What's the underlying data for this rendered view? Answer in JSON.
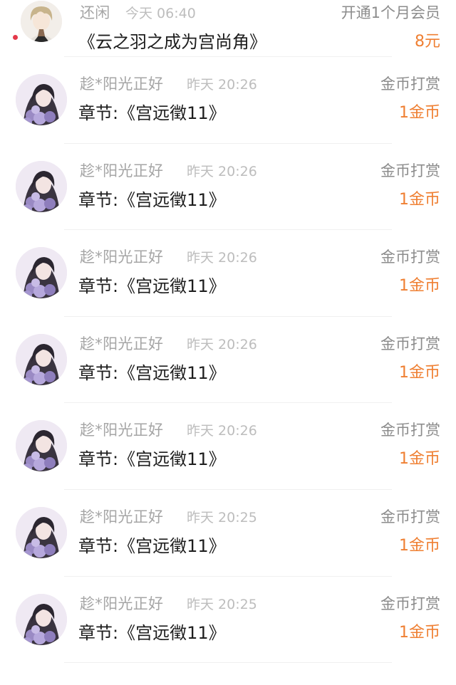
{
  "records": [
    {
      "user": "还闲",
      "time": "今天 06:40",
      "type": "开通1个月会员",
      "item": "《云之羽之成为宫尚角》",
      "amount": "8元",
      "avatar": "male-avatar",
      "unread": true
    },
    {
      "user": "趁*阳光正好",
      "time": "昨天 20:26",
      "type": "金币打赏",
      "item": "章节:《宫远徵11》",
      "amount": "1金币",
      "avatar": "female-avatar"
    },
    {
      "user": "趁*阳光正好",
      "time": "昨天 20:26",
      "type": "金币打赏",
      "item": "章节:《宫远徵11》",
      "amount": "1金币",
      "avatar": "female-avatar"
    },
    {
      "user": "趁*阳光正好",
      "time": "昨天 20:26",
      "type": "金币打赏",
      "item": "章节:《宫远徵11》",
      "amount": "1金币",
      "avatar": "female-avatar"
    },
    {
      "user": "趁*阳光正好",
      "time": "昨天 20:26",
      "type": "金币打赏",
      "item": "章节:《宫远徵11》",
      "amount": "1金币",
      "avatar": "female-avatar"
    },
    {
      "user": "趁*阳光正好",
      "time": "昨天 20:26",
      "type": "金币打赏",
      "item": "章节:《宫远徵11》",
      "amount": "1金币",
      "avatar": "female-avatar"
    },
    {
      "user": "趁*阳光正好",
      "time": "昨天 20:25",
      "type": "金币打赏",
      "item": "章节:《宫远徵11》",
      "amount": "1金币",
      "avatar": "female-avatar"
    },
    {
      "user": "趁*阳光正好",
      "time": "昨天 20:25",
      "type": "金币打赏",
      "item": "章节:《宫远徵11》",
      "amount": "1金币",
      "avatar": "female-avatar"
    }
  ],
  "colors": {
    "amount": "#ef7f32",
    "name": "#a5a5a5",
    "time": "#bdbdbd",
    "kind": "#8c8c8c",
    "title": "#1d1d1d",
    "unread_dot": "#e4394a"
  }
}
